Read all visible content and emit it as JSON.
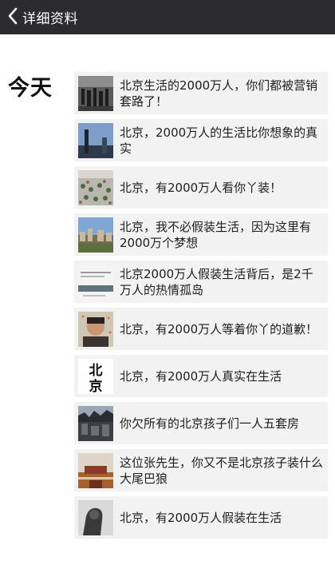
{
  "navbar": {
    "back_label": "详细资料",
    "back_icon": "chevron-left-icon"
  },
  "section": {
    "day_label": "今天"
  },
  "posts": [
    {
      "title": "北京生活的2000万人，你们都被营销套路了！"
    },
    {
      "title": "北京，2000万人的生活比你想象的真实"
    },
    {
      "title": "北京，有2000万人看你丫装！"
    },
    {
      "title": "北京，我不必假装生活，因为这里有2000万个梦想"
    },
    {
      "title": "北京2000万人假装生活背后，是2千万人的热情孤岛"
    },
    {
      "title": "北京，有2000万人等着你丫的道歉！"
    },
    {
      "title": "北京，有2000万人真实在生活",
      "thumb_text": "北京"
    },
    {
      "title": "你欠所有的北京孩子们一人五套房"
    },
    {
      "title": "这位张先生，你又不是北京孩子装什么大尾巴狼"
    },
    {
      "title": "北京，有2000万人假装在生活"
    }
  ]
}
